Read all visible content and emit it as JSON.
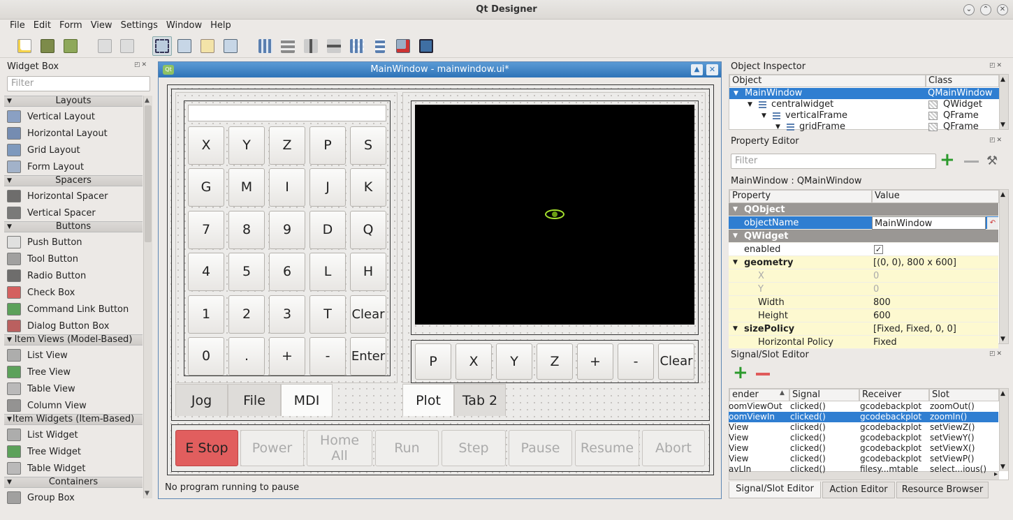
{
  "app": {
    "title": "Qt Designer"
  },
  "menus": [
    "File",
    "Edit",
    "Form",
    "View",
    "Settings",
    "Window",
    "Help"
  ],
  "colors": {
    "accent": "#3d8ee0",
    "estop": "#e15e5e",
    "plot_bg": "#000000",
    "highlight": "#2f7ed1"
  },
  "widget_box": {
    "title": "Widget Box",
    "filter_placeholder": "Filter",
    "categories": [
      {
        "name": "Layouts",
        "items": [
          "Vertical Layout",
          "Horizontal Layout",
          "Grid Layout",
          "Form Layout"
        ]
      },
      {
        "name": "Spacers",
        "items": [
          "Horizontal Spacer",
          "Vertical Spacer"
        ]
      },
      {
        "name": "Buttons",
        "items": [
          "Push Button",
          "Tool Button",
          "Radio Button",
          "Check Box",
          "Command Link Button",
          "Dialog Button Box"
        ]
      },
      {
        "name": "Item Views (Model-Based)",
        "items": [
          "List View",
          "Tree View",
          "Table View",
          "Column View"
        ]
      },
      {
        "name": "Item Widgets (Item-Based)",
        "items": [
          "List Widget",
          "Tree Widget",
          "Table Widget"
        ]
      },
      {
        "name": "Containers",
        "items": [
          "Group Box"
        ]
      }
    ]
  },
  "form": {
    "title": "MainWindow - mainwindow.ui*",
    "keypad": [
      [
        "X",
        "Y",
        "Z",
        "P",
        "S"
      ],
      [
        "G",
        "M",
        "I",
        "J",
        "K"
      ],
      [
        "7",
        "8",
        "9",
        "D",
        "Q"
      ],
      [
        "4",
        "5",
        "6",
        "L",
        "H"
      ],
      [
        "1",
        "2",
        "3",
        "T",
        "Clear"
      ],
      [
        "0",
        ".",
        "+",
        "-",
        "Enter"
      ]
    ],
    "left_tabs": [
      "Jog",
      "File",
      "MDI"
    ],
    "active_left_tab": "MDI",
    "plot_buttons": [
      "P",
      "X",
      "Y",
      "Z",
      "+",
      "-",
      "Clear"
    ],
    "right_tabs": [
      "Plot",
      "Tab 2"
    ],
    "active_right_tab": "Plot",
    "bottom_buttons": [
      "E Stop",
      "Power",
      "Home All",
      "Run",
      "Step",
      "Pause",
      "Resume",
      "Abort"
    ],
    "status": "No program running to pause"
  },
  "object_inspector": {
    "title": "Object Inspector",
    "headers": [
      "Object",
      "Class"
    ],
    "rows": [
      {
        "name": "MainWindow",
        "cls": "QMainWindow",
        "selected": true
      },
      {
        "name": "centralwidget",
        "cls": "QWidget"
      },
      {
        "name": "verticalFrame",
        "cls": "QFrame"
      },
      {
        "name": "gridFrame",
        "cls": "QFrame"
      }
    ]
  },
  "property_editor": {
    "title": "Property Editor",
    "filter_placeholder": "Filter",
    "subtitle": "MainWindow : QMainWindow",
    "headers": [
      "Property",
      "Value"
    ],
    "rows": [
      {
        "prop": "QObject",
        "val": "",
        "type": "group"
      },
      {
        "prop": "objectName",
        "val": "MainWindow",
        "type": "selected"
      },
      {
        "prop": "QWidget",
        "val": "",
        "type": "group"
      },
      {
        "prop": "enabled",
        "val": "✓",
        "type": "normal"
      },
      {
        "prop": "geometry",
        "val": "[(0, 0), 800 x 600]",
        "type": "bold"
      },
      {
        "prop": "X",
        "val": "0",
        "type": "dim"
      },
      {
        "prop": "Y",
        "val": "0",
        "type": "dim"
      },
      {
        "prop": "Width",
        "val": "800",
        "type": "sub"
      },
      {
        "prop": "Height",
        "val": "600",
        "type": "sub"
      },
      {
        "prop": "sizePolicy",
        "val": "[Fixed, Fixed, 0, 0]",
        "type": "bold"
      },
      {
        "prop": "Horizontal Policy",
        "val": "Fixed",
        "type": "sub"
      }
    ]
  },
  "signal_slot": {
    "title": "Signal/Slot Editor",
    "headers": [
      "ender",
      "Signal",
      "Receiver",
      "Slot"
    ],
    "rows": [
      [
        "oomViewOut",
        "clicked()",
        "gcodebackplot",
        "zoomOut()"
      ],
      [
        "oomViewIn",
        "clicked()",
        "gcodebackplot",
        "zoomIn()"
      ],
      [
        "View",
        "clicked()",
        "gcodebackplot",
        "setViewZ()"
      ],
      [
        "View",
        "clicked()",
        "gcodebackplot",
        "setViewY()"
      ],
      [
        "View",
        "clicked()",
        "gcodebackplot",
        "setViewX()"
      ],
      [
        "View",
        "clicked()",
        "gcodebackplot",
        "setViewP()"
      ],
      [
        "avLIn",
        "clicked()",
        "filesy...mtable",
        "select...ious()"
      ]
    ],
    "selected_row": 1,
    "tabs": [
      "Signal/Slot Editor",
      "Action Editor",
      "Resource Browser"
    ]
  }
}
